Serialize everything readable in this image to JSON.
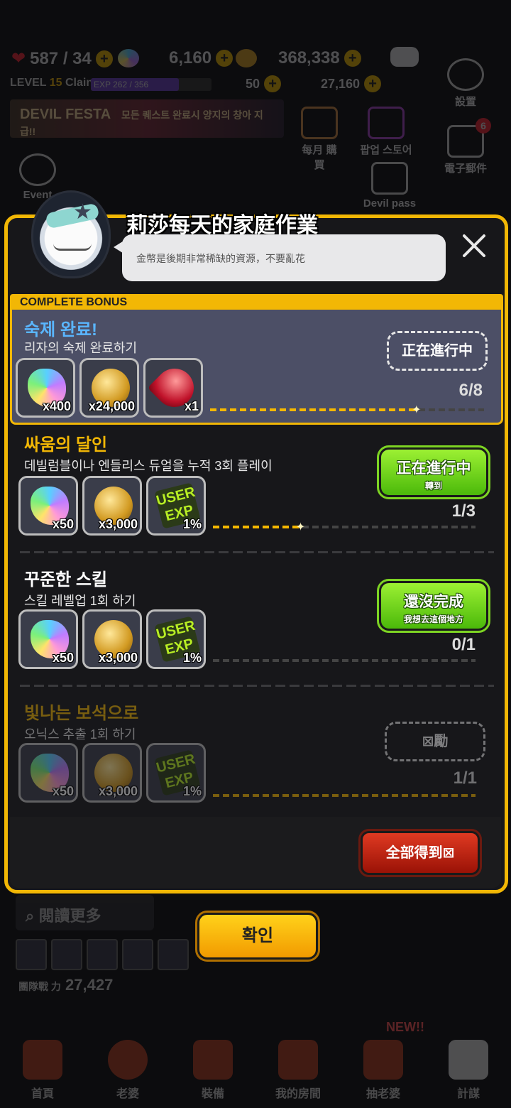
{
  "hud": {
    "hearts": "587 / 34",
    "gems": "6,160",
    "gold": "368,338",
    "level_label": "LEVEL",
    "level_num": "15",
    "player_name": "Clainss",
    "exp": "EXP 262 / 356",
    "tickets": "50",
    "souls": "27,160",
    "banner_text": "DEVIL FESTA",
    "banner_sub": "모든 퀘스트 완료시 양지의 창아 지급!!",
    "settings_label": "設置",
    "mail_label": "電子郵件",
    "mail_badge": "6",
    "monthly_label": "每月 購買",
    "popup_store_label": "팝업 스토어",
    "devil_pass_label": "Devil pass",
    "event_label": "Event"
  },
  "popup": {
    "title": "莉莎每天的家庭作業",
    "speech": "金幣是後期非常稀缺的資源，不要亂花",
    "complete_bonus_label": "COMPLETE BONUS",
    "quests": [
      {
        "title": "숙제 완료!",
        "desc": "리자의 숙제 완료하기",
        "rewards": [
          {
            "type": "gem",
            "qty": "x400"
          },
          {
            "type": "gold",
            "qty": "x24,000"
          },
          {
            "type": "ruby",
            "qty": "x1"
          }
        ],
        "progress_text": "6/8",
        "progress": 0.75,
        "status": "正在進行中"
      },
      {
        "title": "싸움의 달인",
        "desc": "데빌럼블이나 엔들리스 듀얼을 누적 3회 플레이",
        "rewards": [
          {
            "type": "gem",
            "qty": "x50"
          },
          {
            "type": "gold",
            "qty": "x3,000"
          },
          {
            "type": "exp",
            "qty": "1%",
            "art": "USER EXP"
          }
        ],
        "progress_text": "1/3",
        "progress": 0.33,
        "status": "正在進行中",
        "status_sub": "轉到"
      },
      {
        "title": "꾸준한 스킬",
        "desc": "스킬 레벨업 1회 하기",
        "rewards": [
          {
            "type": "gem",
            "qty": "x50"
          },
          {
            "type": "gold",
            "qty": "x3,000"
          },
          {
            "type": "exp",
            "qty": "1%",
            "art": "USER EXP"
          }
        ],
        "progress_text": "0/1",
        "progress": 0,
        "status": "還沒完成",
        "status_sub": "我想去這個地方"
      },
      {
        "title": "빛나는 보석으로",
        "desc": "오닉스 추출 1회 하기",
        "rewards": [
          {
            "type": "gem",
            "qty": "x50"
          },
          {
            "type": "gold",
            "qty": "x3,000"
          },
          {
            "type": "exp",
            "qty": "1%",
            "art": "USER EXP"
          }
        ],
        "progress_text": "1/1",
        "progress": 1,
        "status": "⊠勵"
      }
    ],
    "collect_all": "全部得到⊠"
  },
  "below": {
    "search_label": "閱讀更多",
    "power_label": "團隊戰 力",
    "power_value": "27,427"
  },
  "confirm": "확인",
  "nav": [
    {
      "label": "首頁"
    },
    {
      "label": "老婆"
    },
    {
      "label": "裝備"
    },
    {
      "label": "我的房間"
    },
    {
      "label": "抽老婆"
    },
    {
      "label": "計謀"
    }
  ],
  "nav_new_badge": "NEW!!",
  "colors": {
    "accent_yellow": "#f2b705",
    "green_button": "#4bb90a",
    "red_button": "#c0200e",
    "bonus_card": "#4c4f66"
  }
}
